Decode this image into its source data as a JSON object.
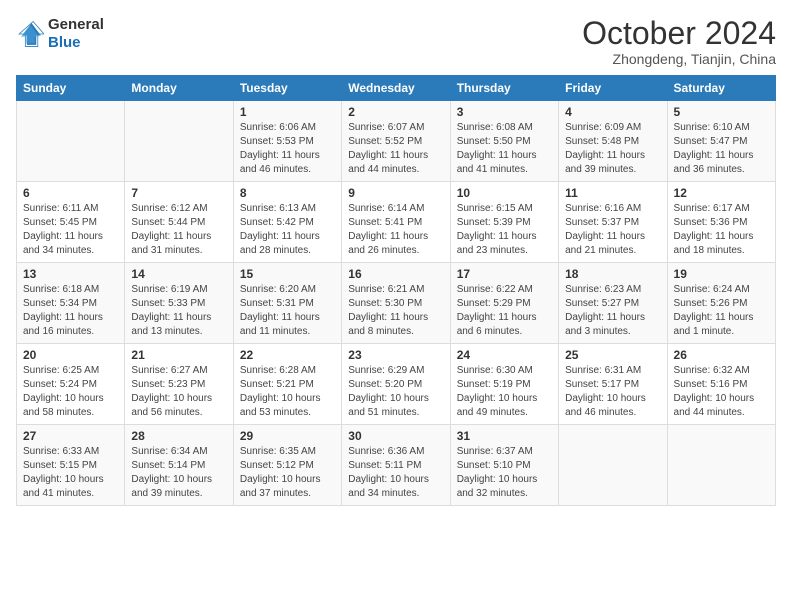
{
  "logo": {
    "general": "General",
    "blue": "Blue"
  },
  "title": {
    "month": "October 2024",
    "location": "Zhongdeng, Tianjin, China"
  },
  "days_of_week": [
    "Sunday",
    "Monday",
    "Tuesday",
    "Wednesday",
    "Thursday",
    "Friday",
    "Saturday"
  ],
  "weeks": [
    [
      {
        "num": "",
        "sunrise": "",
        "sunset": "",
        "daylight": ""
      },
      {
        "num": "",
        "sunrise": "",
        "sunset": "",
        "daylight": ""
      },
      {
        "num": "1",
        "sunrise": "Sunrise: 6:06 AM",
        "sunset": "Sunset: 5:53 PM",
        "daylight": "Daylight: 11 hours and 46 minutes."
      },
      {
        "num": "2",
        "sunrise": "Sunrise: 6:07 AM",
        "sunset": "Sunset: 5:52 PM",
        "daylight": "Daylight: 11 hours and 44 minutes."
      },
      {
        "num": "3",
        "sunrise": "Sunrise: 6:08 AM",
        "sunset": "Sunset: 5:50 PM",
        "daylight": "Daylight: 11 hours and 41 minutes."
      },
      {
        "num": "4",
        "sunrise": "Sunrise: 6:09 AM",
        "sunset": "Sunset: 5:48 PM",
        "daylight": "Daylight: 11 hours and 39 minutes."
      },
      {
        "num": "5",
        "sunrise": "Sunrise: 6:10 AM",
        "sunset": "Sunset: 5:47 PM",
        "daylight": "Daylight: 11 hours and 36 minutes."
      }
    ],
    [
      {
        "num": "6",
        "sunrise": "Sunrise: 6:11 AM",
        "sunset": "Sunset: 5:45 PM",
        "daylight": "Daylight: 11 hours and 34 minutes."
      },
      {
        "num": "7",
        "sunrise": "Sunrise: 6:12 AM",
        "sunset": "Sunset: 5:44 PM",
        "daylight": "Daylight: 11 hours and 31 minutes."
      },
      {
        "num": "8",
        "sunrise": "Sunrise: 6:13 AM",
        "sunset": "Sunset: 5:42 PM",
        "daylight": "Daylight: 11 hours and 28 minutes."
      },
      {
        "num": "9",
        "sunrise": "Sunrise: 6:14 AM",
        "sunset": "Sunset: 5:41 PM",
        "daylight": "Daylight: 11 hours and 26 minutes."
      },
      {
        "num": "10",
        "sunrise": "Sunrise: 6:15 AM",
        "sunset": "Sunset: 5:39 PM",
        "daylight": "Daylight: 11 hours and 23 minutes."
      },
      {
        "num": "11",
        "sunrise": "Sunrise: 6:16 AM",
        "sunset": "Sunset: 5:37 PM",
        "daylight": "Daylight: 11 hours and 21 minutes."
      },
      {
        "num": "12",
        "sunrise": "Sunrise: 6:17 AM",
        "sunset": "Sunset: 5:36 PM",
        "daylight": "Daylight: 11 hours and 18 minutes."
      }
    ],
    [
      {
        "num": "13",
        "sunrise": "Sunrise: 6:18 AM",
        "sunset": "Sunset: 5:34 PM",
        "daylight": "Daylight: 11 hours and 16 minutes."
      },
      {
        "num": "14",
        "sunrise": "Sunrise: 6:19 AM",
        "sunset": "Sunset: 5:33 PM",
        "daylight": "Daylight: 11 hours and 13 minutes."
      },
      {
        "num": "15",
        "sunrise": "Sunrise: 6:20 AM",
        "sunset": "Sunset: 5:31 PM",
        "daylight": "Daylight: 11 hours and 11 minutes."
      },
      {
        "num": "16",
        "sunrise": "Sunrise: 6:21 AM",
        "sunset": "Sunset: 5:30 PM",
        "daylight": "Daylight: 11 hours and 8 minutes."
      },
      {
        "num": "17",
        "sunrise": "Sunrise: 6:22 AM",
        "sunset": "Sunset: 5:29 PM",
        "daylight": "Daylight: 11 hours and 6 minutes."
      },
      {
        "num": "18",
        "sunrise": "Sunrise: 6:23 AM",
        "sunset": "Sunset: 5:27 PM",
        "daylight": "Daylight: 11 hours and 3 minutes."
      },
      {
        "num": "19",
        "sunrise": "Sunrise: 6:24 AM",
        "sunset": "Sunset: 5:26 PM",
        "daylight": "Daylight: 11 hours and 1 minute."
      }
    ],
    [
      {
        "num": "20",
        "sunrise": "Sunrise: 6:25 AM",
        "sunset": "Sunset: 5:24 PM",
        "daylight": "Daylight: 10 hours and 58 minutes."
      },
      {
        "num": "21",
        "sunrise": "Sunrise: 6:27 AM",
        "sunset": "Sunset: 5:23 PM",
        "daylight": "Daylight: 10 hours and 56 minutes."
      },
      {
        "num": "22",
        "sunrise": "Sunrise: 6:28 AM",
        "sunset": "Sunset: 5:21 PM",
        "daylight": "Daylight: 10 hours and 53 minutes."
      },
      {
        "num": "23",
        "sunrise": "Sunrise: 6:29 AM",
        "sunset": "Sunset: 5:20 PM",
        "daylight": "Daylight: 10 hours and 51 minutes."
      },
      {
        "num": "24",
        "sunrise": "Sunrise: 6:30 AM",
        "sunset": "Sunset: 5:19 PM",
        "daylight": "Daylight: 10 hours and 49 minutes."
      },
      {
        "num": "25",
        "sunrise": "Sunrise: 6:31 AM",
        "sunset": "Sunset: 5:17 PM",
        "daylight": "Daylight: 10 hours and 46 minutes."
      },
      {
        "num": "26",
        "sunrise": "Sunrise: 6:32 AM",
        "sunset": "Sunset: 5:16 PM",
        "daylight": "Daylight: 10 hours and 44 minutes."
      }
    ],
    [
      {
        "num": "27",
        "sunrise": "Sunrise: 6:33 AM",
        "sunset": "Sunset: 5:15 PM",
        "daylight": "Daylight: 10 hours and 41 minutes."
      },
      {
        "num": "28",
        "sunrise": "Sunrise: 6:34 AM",
        "sunset": "Sunset: 5:14 PM",
        "daylight": "Daylight: 10 hours and 39 minutes."
      },
      {
        "num": "29",
        "sunrise": "Sunrise: 6:35 AM",
        "sunset": "Sunset: 5:12 PM",
        "daylight": "Daylight: 10 hours and 37 minutes."
      },
      {
        "num": "30",
        "sunrise": "Sunrise: 6:36 AM",
        "sunset": "Sunset: 5:11 PM",
        "daylight": "Daylight: 10 hours and 34 minutes."
      },
      {
        "num": "31",
        "sunrise": "Sunrise: 6:37 AM",
        "sunset": "Sunset: 5:10 PM",
        "daylight": "Daylight: 10 hours and 32 minutes."
      },
      {
        "num": "",
        "sunrise": "",
        "sunset": "",
        "daylight": ""
      },
      {
        "num": "",
        "sunrise": "",
        "sunset": "",
        "daylight": ""
      }
    ]
  ]
}
